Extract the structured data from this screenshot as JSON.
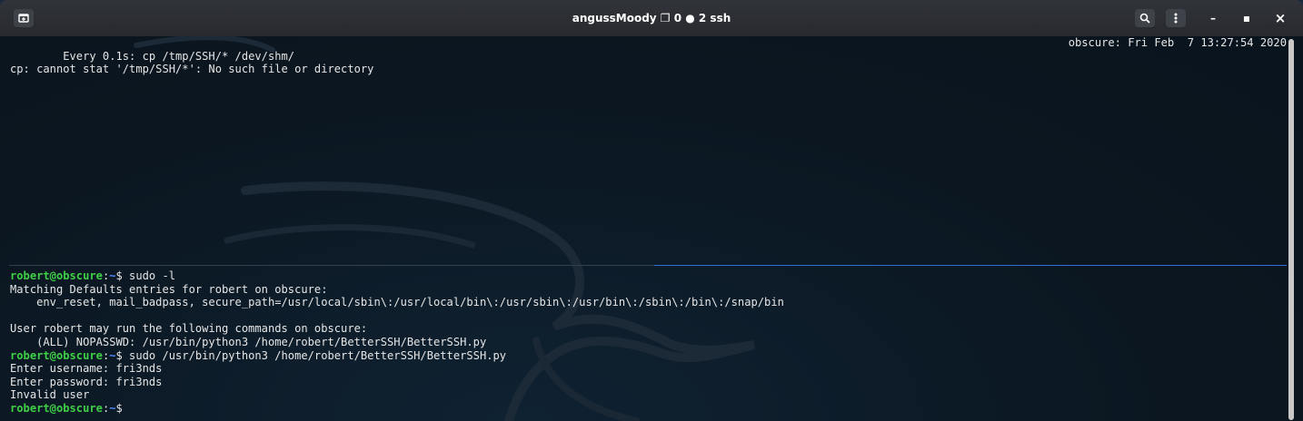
{
  "window": {
    "title": "angussMoody ❐ 0 ● 2 ssh",
    "buttons": {
      "new_tab_icon": "new-tab-icon",
      "search_icon": "search-icon",
      "menu_icon": "menu-icon",
      "minimize": "–",
      "maximize": "▪",
      "close": "×"
    }
  },
  "top_pane": {
    "watch_header": "Every 0.1s: cp /tmp/SSH/* /dev/shm/",
    "watch_status": "obscure: Fri Feb  7 13:27:54 2020",
    "error_line": "cp: cannot stat '/tmp/SSH/*': No such file or directory"
  },
  "bottom_pane": {
    "prompt_user": "robert@obscure",
    "prompt_path": "~",
    "prompt_sym": "$",
    "cmd1": " sudo -l",
    "out1": "Matching Defaults entries for robert on obscure:",
    "out2": "    env_reset, mail_badpass, secure_path=/usr/local/sbin\\:/usr/local/bin\\:/usr/sbin\\:/usr/bin\\:/sbin\\:/bin\\:/snap/bin",
    "out3": "",
    "out4": "User robert may run the following commands on obscure:",
    "out5": "    (ALL) NOPASSWD: /usr/bin/python3 /home/robert/BetterSSH/BetterSSH.py",
    "cmd2": " sudo /usr/bin/python3 /home/robert/BetterSSH/BetterSSH.py",
    "out6": "Enter username: fri3nds",
    "out7": "Enter password: fri3nds",
    "out8": "Invalid user"
  },
  "colors": {
    "prompt_user": "#3fd047",
    "prompt_path": "#4f8bff",
    "active_pane_border": "#2f6fd6"
  }
}
